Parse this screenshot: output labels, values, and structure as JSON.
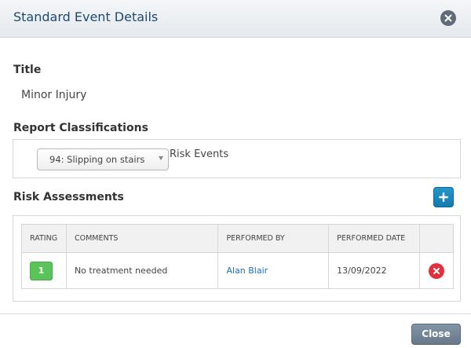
{
  "dialog": {
    "title": "Standard Event Details"
  },
  "title_section": {
    "label": "Title",
    "value": "Minor Injury"
  },
  "report_classifications": {
    "label": "Report Classifications",
    "selected": "94: Slipping on stairs",
    "text": "Risk Events"
  },
  "risk_assessments": {
    "label": "Risk Assessments",
    "columns": [
      "RATING",
      "COMMENTS",
      "PERFORMED BY",
      "PERFORMED DATE"
    ],
    "rows": [
      {
        "rating": "1",
        "comments": "No treatment needed",
        "performed_by": "Alan Blair",
        "performed_date": "13/09/2022"
      }
    ]
  },
  "footer": {
    "close_label": "Close"
  },
  "colors": {
    "rating_green": "#5ac35a",
    "delete_red": "#e4303c",
    "add_blue": "#1f8ec4"
  }
}
